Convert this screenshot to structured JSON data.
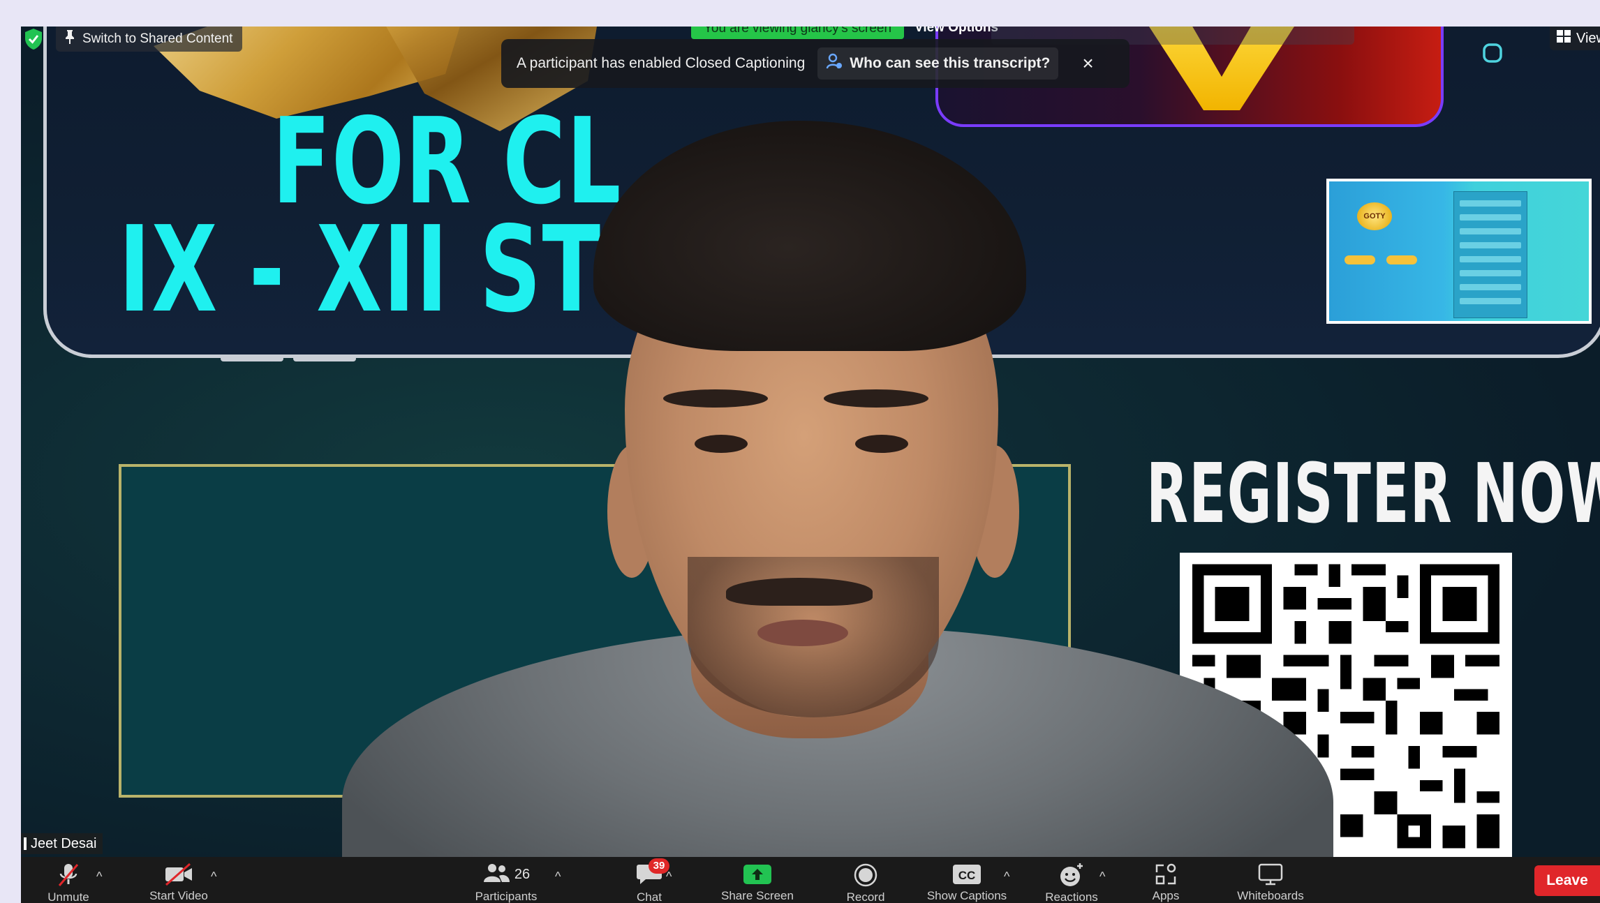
{
  "top_left": {
    "switch_label": "Switch to Shared Content"
  },
  "share_status": {
    "viewing_text": "You are viewing glancy's screen",
    "view_options_label": "View Options"
  },
  "caption_toast": {
    "message": "A participant has enabled Closed Captioning",
    "who_link": "Who can see this transcript?",
    "close_symbol": "×"
  },
  "top_right": {
    "view_label": "View"
  },
  "video": {
    "slide_line_1": "FOR CL",
    "slide_line_2": "IX - XII ST",
    "register_text": "REGISTER NOW",
    "thumb_logo_text": "GOTY",
    "participant_name": "Jeet Desai"
  },
  "controls": {
    "unmute_label": "Unmute",
    "start_video_label": "Start Video",
    "participants_label": "Participants",
    "participants_count": "26",
    "chat_label": "Chat",
    "chat_badge": "39",
    "share_screen_label": "Share Screen",
    "record_label": "Record",
    "captions_label": "Show Captions",
    "captions_icon_text": "CC",
    "reactions_label": "Reactions",
    "apps_label": "Apps",
    "whiteboards_label": "Whiteboards",
    "leave_label": "Leave",
    "caret": "^"
  },
  "colors": {
    "share_green": "#22c352",
    "leave_red": "#e0262a",
    "badge_red": "#e02828",
    "slide_cyan": "#1ff0ef"
  }
}
